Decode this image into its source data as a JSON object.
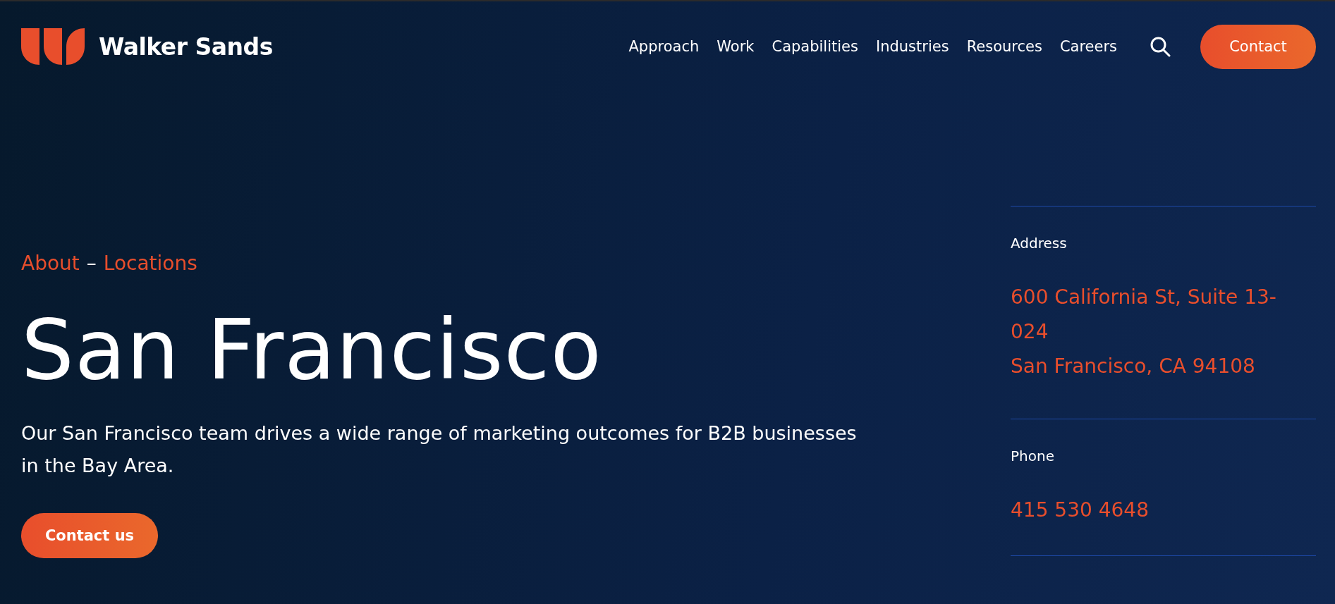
{
  "header": {
    "brand": "Walker Sands",
    "nav": [
      "Approach",
      "Work",
      "Capabilities",
      "Industries",
      "Resources",
      "Careers"
    ],
    "contact_button": "Contact"
  },
  "breadcrumb": [
    "About",
    "Locations"
  ],
  "breadcrumb_separator": "–",
  "title": "San Francisco",
  "description": "Our San Francisco team drives a wide range of marketing outcomes for B2B businesses in the Bay Area.",
  "cta_button": "Contact us",
  "details": [
    {
      "label": "Address",
      "lines": [
        "600 California St, Suite 13-",
        "024",
        "San Francisco, CA 94108"
      ]
    },
    {
      "label": "Phone",
      "lines": [
        "415 530 4648"
      ]
    }
  ]
}
